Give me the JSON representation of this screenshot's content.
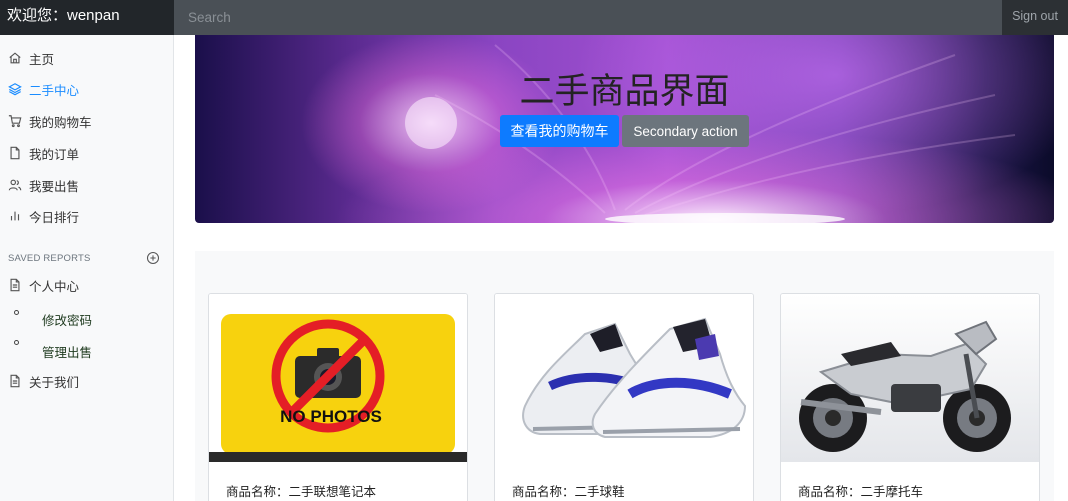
{
  "navbar": {
    "brand": "欢迎您：wenpan",
    "search_placeholder": "Search",
    "signout_label": "Sign out"
  },
  "sidebar": {
    "items": [
      {
        "label": "主页",
        "icon": "home-icon",
        "active": false
      },
      {
        "label": "二手中心",
        "icon": "layers-icon",
        "active": true
      },
      {
        "label": "我的购物车",
        "icon": "cart-icon",
        "active": false
      },
      {
        "label": "我的订单",
        "icon": "file-icon",
        "active": false
      },
      {
        "label": "我要出售",
        "icon": "users-icon",
        "active": false
      },
      {
        "label": "今日排行",
        "icon": "bar-chart-icon",
        "active": false
      }
    ],
    "saved_reports_heading": "SAVED REPORTS",
    "personal_center": "个人中心",
    "sub_items": [
      {
        "label": "修改密码"
      },
      {
        "label": "管理出售"
      }
    ],
    "about": "关于我们"
  },
  "hero": {
    "title": "二手商品界面",
    "primary_button": "查看我的购物车",
    "secondary_button": "Secondary action"
  },
  "products": [
    {
      "name_text": "商品名称：二手联想笔记本",
      "image": "no-photos-sign",
      "image_caption": "NO PHOTOS"
    },
    {
      "name_text": "商品名称：二手球鞋",
      "image": "sneakers-photo"
    },
    {
      "name_text": "商品名称：二手摩托车",
      "image": "motorcycle-photo"
    }
  ],
  "colors": {
    "navbar_bg": "#343a40",
    "accent": "#0d7bff",
    "active_link": "#1a8cff",
    "secondary": "#6c757d"
  }
}
